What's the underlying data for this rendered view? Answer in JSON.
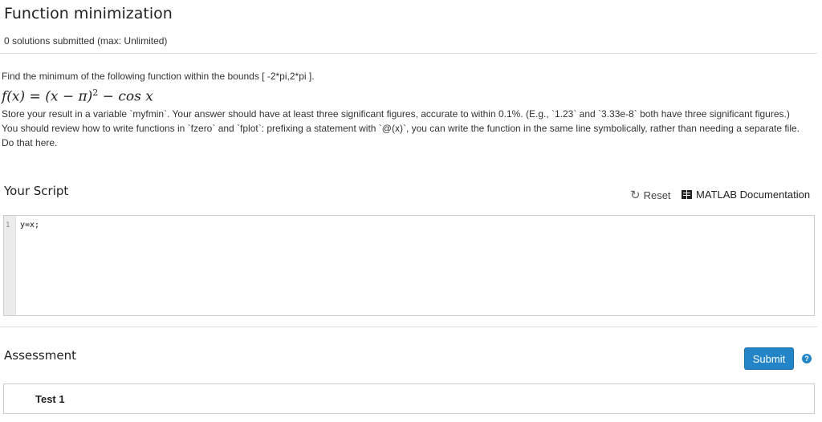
{
  "page": {
    "title": "Function minimization",
    "submissions": "0 solutions submitted (max: Unlimited)"
  },
  "problem": {
    "intro": "Find the minimum of the following function within the bounds [ -2*pi,2*pi ].",
    "formula": {
      "lhs": "f(x) = (x − π)",
      "exponent": "2",
      "rhs": " − cos x"
    },
    "instructions": "Store your result in a variable `myfmin`. Your answer should have at least three significant figures, accurate to within 0.1%. (E.g., `1.23` and `3.33e-8` both have three significant figures.)",
    "hint": "You should review how to write functions in `fzero` and `fplot`: prefixing a statement with `@(x)`, you can write the function in the same line symbolically, rather than needing a separate file. Do that here."
  },
  "script": {
    "heading": "Your Script",
    "reset_label": "Reset",
    "doc_label": "MATLAB Documentation",
    "lines": [
      {
        "number": "1",
        "code": "y=x;"
      }
    ]
  },
  "assessment": {
    "heading": "Assessment",
    "submit_label": "Submit",
    "help_glyph": "?",
    "tests": [
      {
        "label": "Test 1"
      }
    ]
  },
  "icons": {
    "reset": "reset-icon",
    "documentation": "book-icon",
    "help": "question-circle-icon"
  },
  "colors": {
    "accent": "#2385c8"
  }
}
